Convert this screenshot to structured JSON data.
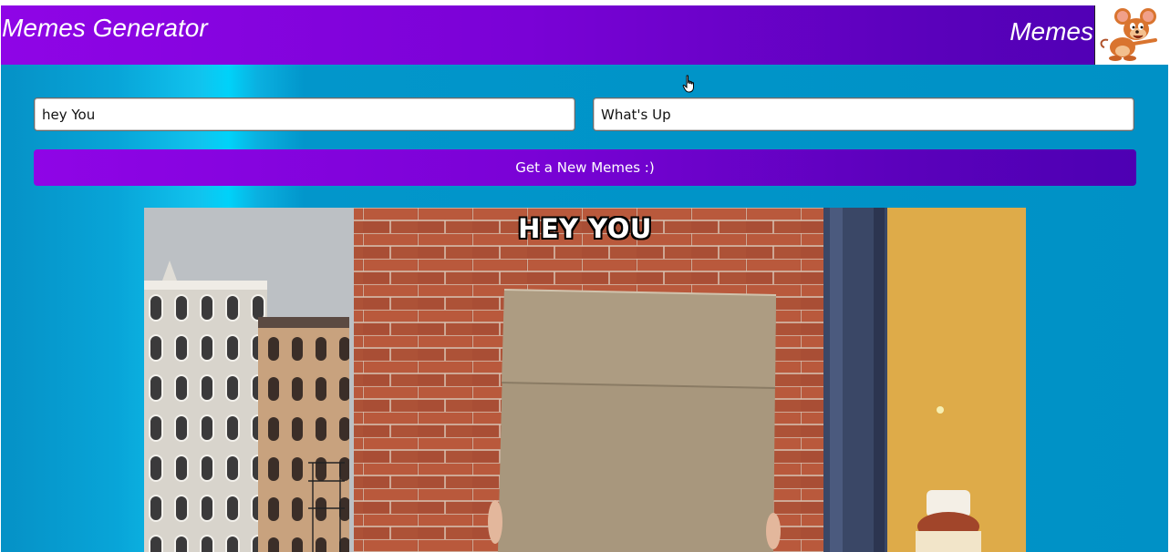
{
  "header": {
    "title": "Memes Generator",
    "nav_label": "Memes",
    "logo_icon": "mouse-cartoon-logo"
  },
  "form": {
    "top_text_value": "hey You",
    "bottom_text_value": "What's Up",
    "button_label": "Get a New Memes :)"
  },
  "meme": {
    "top_text": "hey You"
  },
  "colors": {
    "header_gradient_start": "#8f05e6",
    "header_gradient_end": "#4d00b3",
    "background_blue": "#0094c8",
    "background_highlight": "#00d2f9"
  }
}
